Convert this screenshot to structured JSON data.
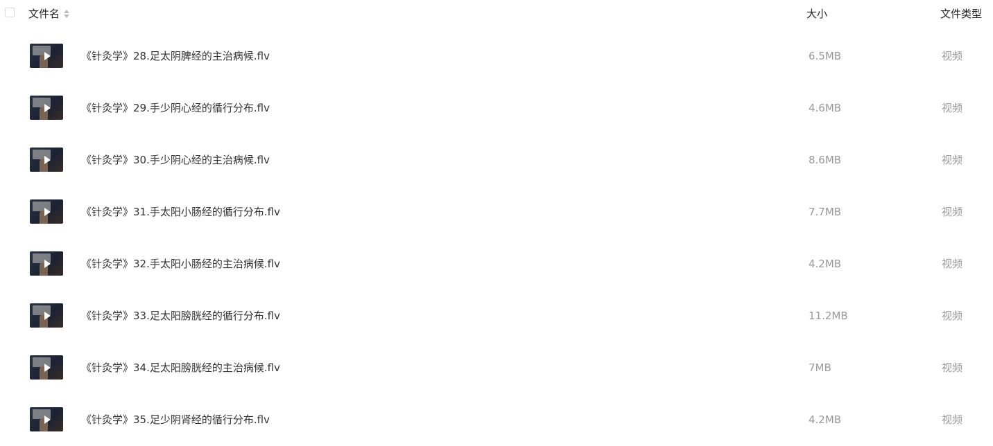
{
  "header": {
    "name_label": "文件名",
    "size_label": "大小",
    "type_label": "文件类型"
  },
  "files": [
    {
      "name": "《针灸学》28.足太阴脾经的主治病候.flv",
      "size": "6.5MB",
      "type": "视频"
    },
    {
      "name": "《针灸学》29.手少阴心经的循行分布.flv",
      "size": "4.6MB",
      "type": "视频"
    },
    {
      "name": "《针灸学》30.手少阴心经的主治病候.flv",
      "size": "8.6MB",
      "type": "视频"
    },
    {
      "name": "《针灸学》31.手太阳小肠经的循行分布.flv",
      "size": "7.7MB",
      "type": "视频"
    },
    {
      "name": "《针灸学》32.手太阳小肠经的主治病候.flv",
      "size": "4.2MB",
      "type": "视频"
    },
    {
      "name": "《针灸学》33.足太阳膀胱经的循行分布.flv",
      "size": "11.2MB",
      "type": "视频"
    },
    {
      "name": "《针灸学》34.足太阳膀胱经的主治病候.flv",
      "size": "7MB",
      "type": "视频"
    },
    {
      "name": "《针灸学》35.足少阴肾经的循行分布.flv",
      "size": "4.2MB",
      "type": "视频"
    }
  ],
  "icons": {
    "sort": "sort-icon",
    "thumbnail": "video-thumbnail",
    "play": "play-icon"
  }
}
